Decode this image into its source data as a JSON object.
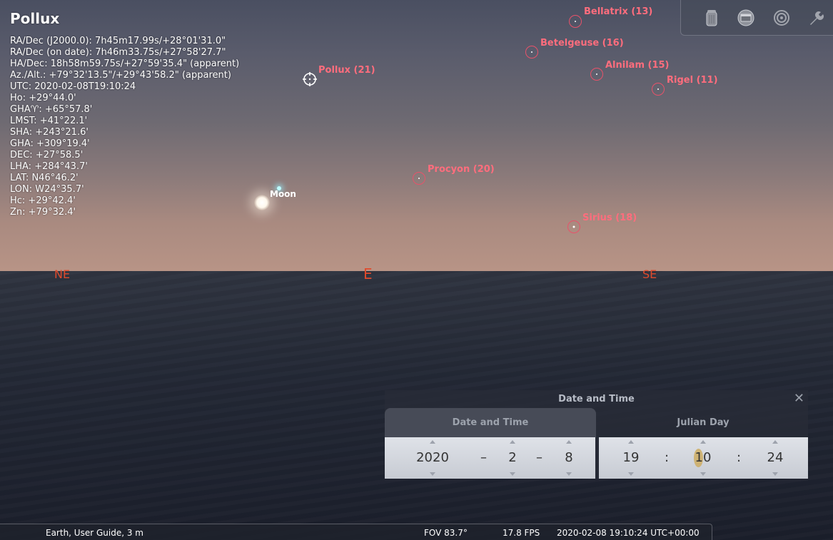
{
  "selected_object": {
    "name": "Pollux",
    "lines": [
      "RA/Dec (J2000.0): 7h45m17.99s/+28°01'31.0\"",
      "RA/Dec (on date): 7h46m33.75s/+27°58'27.7\"",
      "HA/Dec: 18h58m59.75s/+27°59'35.4\" (apparent)",
      "Az./Alt.: +79°32'13.5\"/+29°43'58.2\" (apparent)",
      "UTC: 2020-02-08T19:10:24",
      "Ho: +29°44.0'",
      "GHA♈: +65°57.8'",
      "LMST: +41°22.1'",
      "SHA: +243°21.6'",
      "GHA: +309°19.4'",
      "DEC: +27°58.5'",
      "LHA: +284°43.7'",
      "LAT: N46°46.2'",
      "LON: W24°35.7'",
      "Hc: +29°42.4'",
      "Zn: +79°32.4'"
    ]
  },
  "stars": [
    {
      "label": "Pollux (21)"
    },
    {
      "label": "Bellatrix (13)"
    },
    {
      "label": "Betelgeuse (16)"
    },
    {
      "label": "Alnilam (15)"
    },
    {
      "label": "Rigel (11)"
    },
    {
      "label": "Procyon (20)"
    },
    {
      "label": "Sirius (18)"
    }
  ],
  "moon_label": "Moon",
  "compass": {
    "ne": "NE",
    "e": "E",
    "se": "SE"
  },
  "toolbar": {
    "icons": [
      "trash-icon",
      "window-icon",
      "target-icon",
      "wrench-icon"
    ]
  },
  "dialog": {
    "title": "Date and Time",
    "close": "✕",
    "tabs": [
      "Date and Time",
      "Julian Day"
    ],
    "date": {
      "year": "2020",
      "month": "2",
      "day": "8",
      "sep": "–"
    },
    "time": {
      "hour": "19",
      "minute": "10",
      "second": "24",
      "sep": ":"
    }
  },
  "status": {
    "location": "Earth, User Guide, 3 m",
    "fov": "FOV 83.7°",
    "fps": "17.8 FPS",
    "datetime": "2020-02-08 19:10:24 UTC+00:00"
  },
  "colors": {
    "label": "#ff6d7d",
    "ring": "#e8526a",
    "compass": "#e04a2c"
  }
}
